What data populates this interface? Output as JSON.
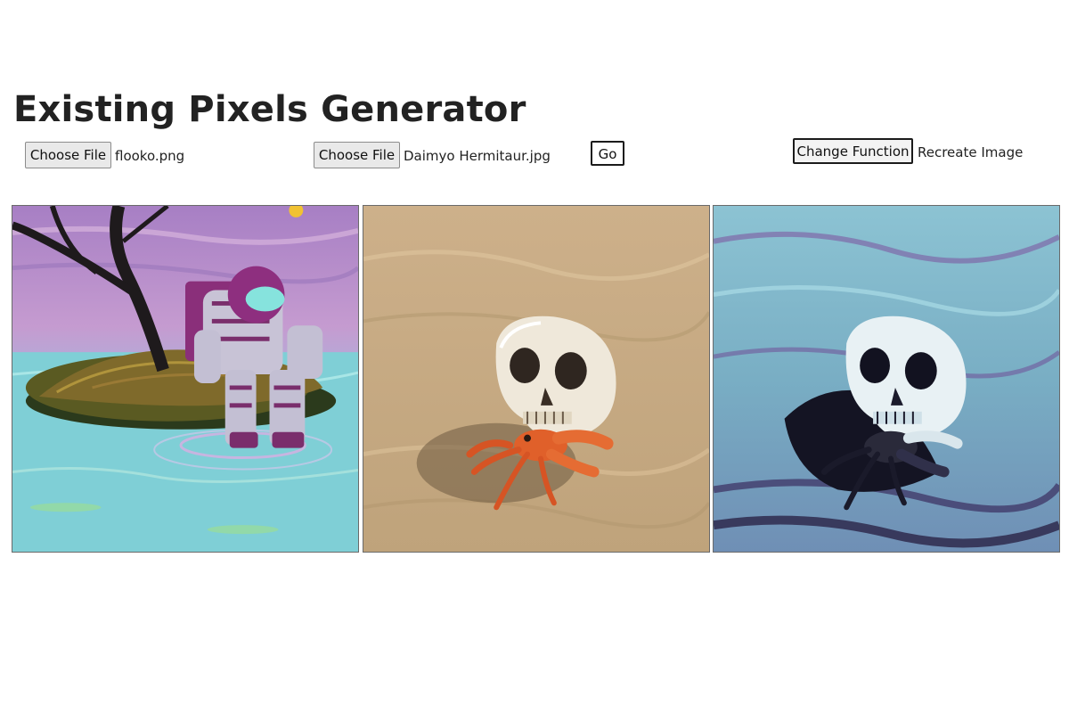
{
  "title": "Existing Pixels Generator",
  "controls": {
    "file1": {
      "button_label": "Choose File",
      "filename": "flooko.png"
    },
    "file2": {
      "button_label": "Choose File",
      "filename": "Daimyo Hermitaur.jpg"
    },
    "go_label": "Go",
    "change_function_label": "Change Function",
    "current_function": "Recreate Image"
  },
  "images": [
    {
      "name": "source-image-astronaut",
      "palette": {
        "sky": "#b489c9",
        "water": "#79d3d8",
        "island": "#5c5a22"
      }
    },
    {
      "name": "target-image-skull-crab",
      "palette": {
        "sand": "#c9ad82",
        "skull": "#efe9dc",
        "crab": "#e0602a"
      }
    },
    {
      "name": "result-image-recreated",
      "palette": {
        "sand": "#7fb7c9",
        "skull": "#e8f1f4",
        "shadow": "#151526"
      }
    }
  ]
}
